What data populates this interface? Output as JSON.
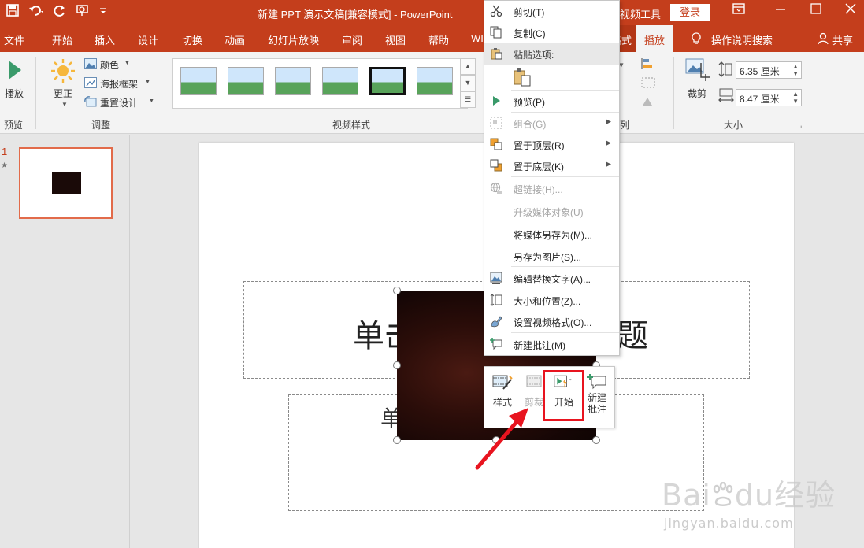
{
  "titlebar": {
    "title": "新建 PPT 演示文稿[兼容模式] - PowerPoint",
    "context_tools": "视频工具",
    "login": "登录"
  },
  "tabs": [
    "文件",
    "开始",
    "插入",
    "设计",
    "切换",
    "动画",
    "幻灯片放映",
    "审阅",
    "视图",
    "帮助",
    "WI"
  ],
  "ctx_tab": "格式",
  "play_tab": "播放",
  "tell_me": "操作说明搜索",
  "share": "共享",
  "ribbon": {
    "play_label": "播放",
    "preview_group": "预览",
    "correct_label": "更正",
    "color_label": "颜色",
    "poster_label": "海报框架",
    "reset_label": "重置设计",
    "adjust_group": "调整",
    "video_styles_group": "视频样式",
    "arrange_group_tail": "列",
    "crop_label": "裁剪",
    "height_value": "6.35 厘米",
    "width_value": "8.47 厘米",
    "size_group": "大小"
  },
  "thumbpane": {
    "slide_number": "1",
    "star": "★"
  },
  "slide": {
    "title_left": "单击",
    "title_right": "题",
    "subtitle_left": "单"
  },
  "context_menu": {
    "items": [
      {
        "label": "剪切(T)",
        "icon": "scissors-icon",
        "disabled": false
      },
      {
        "label": "复制(C)",
        "icon": "copy-icon",
        "disabled": false
      },
      {
        "label": "粘贴选项:",
        "icon": "paste-icon",
        "disabled": false,
        "header": true
      },
      {
        "label": "",
        "icon": "paste-option-icon",
        "disabled": false
      },
      {
        "label": "预览(P)",
        "icon": "play-icon",
        "disabled": false
      },
      {
        "label": "组合(G)",
        "icon": "group-icon",
        "disabled": true,
        "submenu": true
      },
      {
        "label": "置于顶层(R)",
        "icon": "bring-front-icon",
        "disabled": false,
        "submenu": true
      },
      {
        "label": "置于底层(K)",
        "icon": "send-back-icon",
        "disabled": false,
        "submenu": true
      },
      {
        "label": "超链接(H)...",
        "icon": "hyperlink-icon",
        "disabled": true
      },
      {
        "label": "升级媒体对象(U)",
        "icon": "",
        "disabled": true
      },
      {
        "label": "将媒体另存为(M)...",
        "icon": "",
        "disabled": false
      },
      {
        "label": "另存为图片(S)...",
        "icon": "",
        "disabled": false
      },
      {
        "label": "编辑替换文字(A)...",
        "icon": "alt-text-icon",
        "disabled": false
      },
      {
        "label": "大小和位置(Z)...",
        "icon": "size-position-icon",
        "disabled": false
      },
      {
        "label": "设置视频格式(O)...",
        "icon": "format-video-icon",
        "disabled": false
      },
      {
        "label": "新建批注(M)",
        "icon": "new-comment-icon",
        "disabled": false
      }
    ]
  },
  "mini_toolbar": {
    "style_label": "样式",
    "trim_label": "剪裁",
    "start_label": "开始",
    "comment_label_1": "新建",
    "comment_label_2": "批注"
  },
  "watermark": {
    "brand": "Bai",
    "brand_du": "du",
    "cn": "经验",
    "url": "jingyan.baidu.com"
  },
  "colors": {
    "accent": "#c43e1c",
    "highlight_box": "#e8141f",
    "arrow": "#e8141f"
  }
}
